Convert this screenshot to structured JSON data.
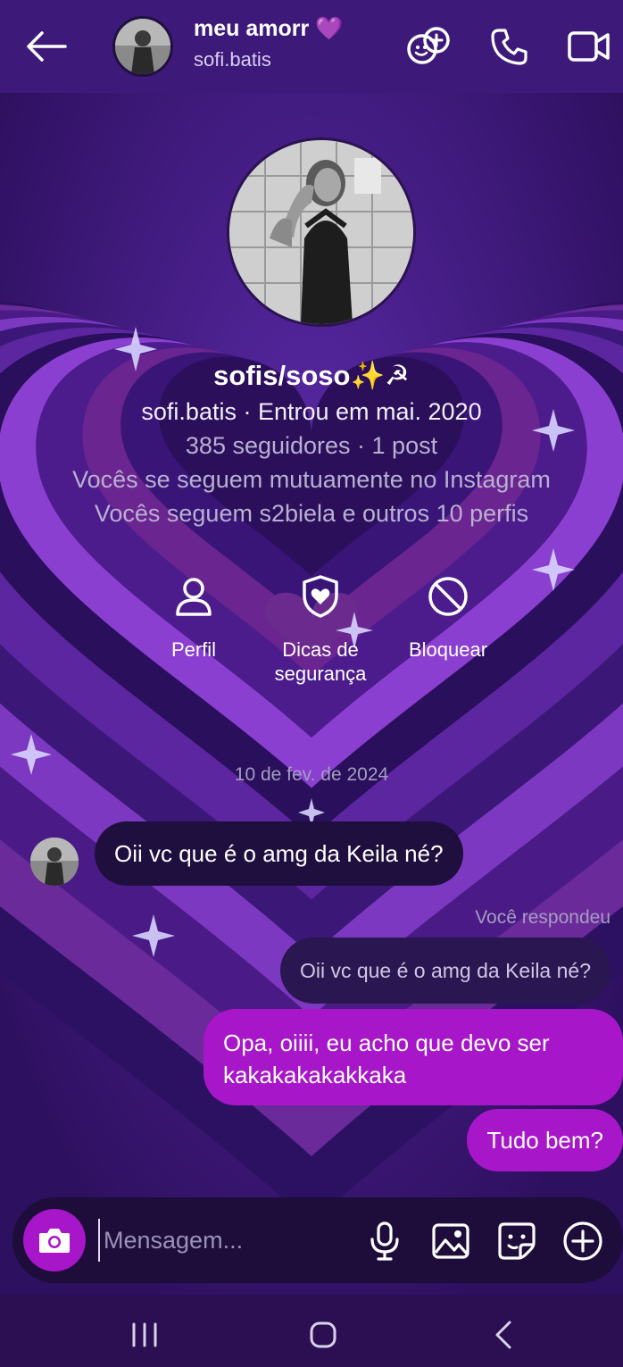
{
  "header": {
    "contact_name": "meu amorr 💜",
    "username": "sofi.batis",
    "icons": [
      "back-arrow-icon",
      "effects-icon",
      "phone-icon",
      "video-camera-icon"
    ]
  },
  "profile": {
    "display_name": "sofis/soso✨☭",
    "line1": "sofi.batis · Entrou em mai. 2020",
    "line2": "385 seguidores · 1 post",
    "line3": "Vocês se seguem mutuamente no Instagram",
    "line4": "Vocês seguem s2biela e outros 10 perfis",
    "actions": [
      {
        "label": "Perfil",
        "icon": "person-icon"
      },
      {
        "label": "Dicas de segurança",
        "icon": "shield-heart-icon"
      },
      {
        "label": "Bloquear",
        "icon": "block-icon"
      }
    ]
  },
  "conversation": {
    "date": "10 de fev. de 2024",
    "messages": [
      {
        "from": "them",
        "text": "Oii vc que é o amg da Keila né?"
      },
      {
        "from": "me",
        "reply_label": "Você respondeu",
        "quoted": "Oii vc que é o amg da Keila né?",
        "text": "Opa, oiiii, eu acho que devo ser kakakakakakkaka"
      },
      {
        "from": "me",
        "text": "Tudo bem?"
      }
    ]
  },
  "composer": {
    "placeholder": "Mensagem...",
    "icons": [
      "camera-icon",
      "microphone-icon",
      "gallery-icon",
      "sticker-icon",
      "plus-icon"
    ]
  },
  "system_nav": {
    "icons": [
      "recent-apps-icon",
      "home-icon",
      "back-icon"
    ]
  },
  "colors": {
    "background": "#3a1673",
    "accent": "#a716c8",
    "incoming_bubble": "#1f0f3e",
    "composer": "#1e0c3a",
    "heart_pink": "#6b2590"
  }
}
